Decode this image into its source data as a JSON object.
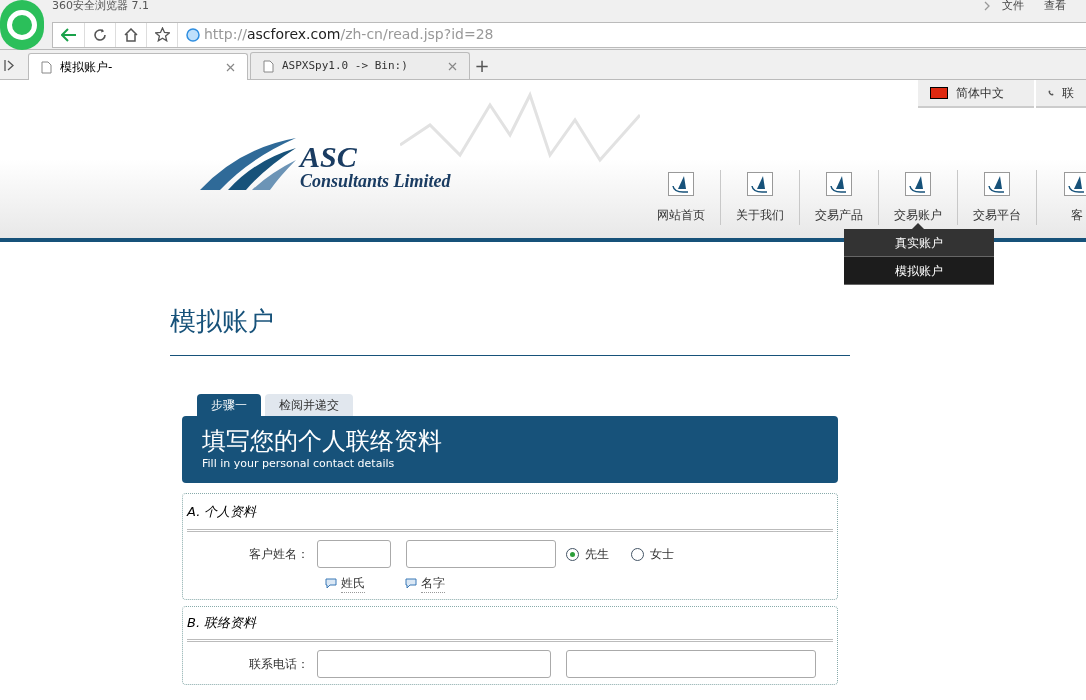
{
  "browser": {
    "title": "360安全浏览器 7.1",
    "menu": [
      "文件",
      "查看"
    ],
    "url_host": "http://ascforex.com",
    "url_path": "/zh-cn/read.jsp?id=28",
    "tabs": [
      {
        "label": "模拟账户-",
        "selected": true
      },
      {
        "label": "ASPXSpy1.0 -> Bin:)",
        "selected": false
      }
    ],
    "new_tab": "+"
  },
  "header": {
    "logo_title": "ASC",
    "logo_subtitle": "Consultants Limited",
    "top_links": [
      "简体中文",
      "联"
    ],
    "nav": [
      {
        "label": "网站首页",
        "expanded": false
      },
      {
        "label": "关于我们",
        "expanded": false
      },
      {
        "label": "交易产品",
        "expanded": false
      },
      {
        "label": "交易账户",
        "expanded": true,
        "submenu": [
          {
            "label": "真实账户",
            "selected": false
          },
          {
            "label": "模拟账户",
            "selected": true
          }
        ]
      },
      {
        "label": "交易平台",
        "expanded": false
      },
      {
        "label": "客",
        "expanded": false
      }
    ]
  },
  "page_title": "模拟账户",
  "form_tabs": [
    {
      "label": "步骤一",
      "selected": true
    },
    {
      "label": "检阅并递交",
      "selected": false
    }
  ],
  "banner": {
    "title": "填写您的个人联络资料",
    "subtitle": "Fill in your personal contact details"
  },
  "section_a": {
    "title": "A. 个人资料",
    "label": "客户姓名：",
    "hints": [
      "姓氏",
      "名字"
    ],
    "options": [
      {
        "label": "先生",
        "selected": true
      },
      {
        "label": "女士",
        "selected": false
      }
    ]
  },
  "section_b": {
    "title": "B. 联络资料",
    "label": "联系电话："
  }
}
